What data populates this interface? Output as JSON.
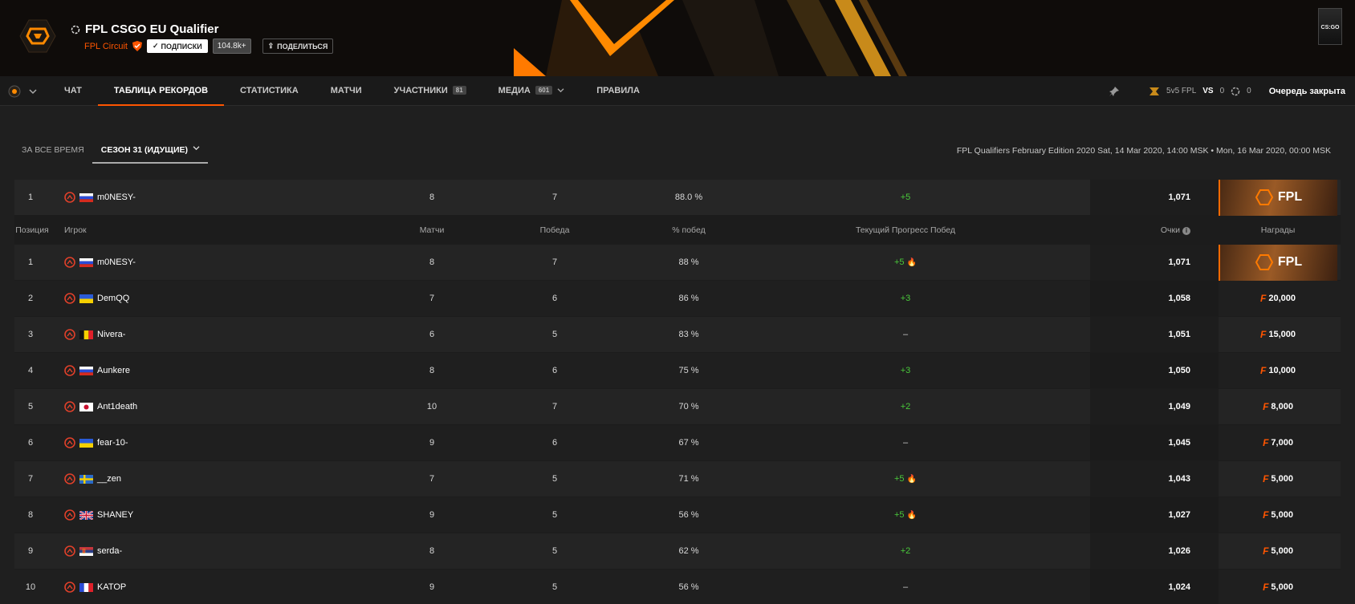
{
  "header": {
    "title": "FPL CSGO EU Qualifier",
    "org_name": "FPL Circuit",
    "follow_label": "ПОДПИСКИ",
    "follow_count": "104.8k+",
    "share_label": "ПОДЕЛИТЬСЯ",
    "game_thumb_label": "CS:GO"
  },
  "nav": {
    "tabs": [
      {
        "label": "ЧАТ",
        "badge": ""
      },
      {
        "label": "ТАБЛИЦА РЕКОРДОВ",
        "badge": ""
      },
      {
        "label": "СТАТИСТИКА",
        "badge": ""
      },
      {
        "label": "МАТЧИ",
        "badge": ""
      },
      {
        "label": "УЧАСТНИКИ",
        "badge": "81"
      },
      {
        "label": "МЕДИА",
        "badge": "601"
      },
      {
        "label": "ПРАВИЛА",
        "badge": ""
      }
    ],
    "queue_mode": "5v5 FPL",
    "vs_label": "VS",
    "queue_count_a": "0",
    "queue_count_b": "0",
    "queue_status": "Очередь закрыта"
  },
  "filters": {
    "all_time": "ЗА ВСЕ ВРЕМЯ",
    "season": "СЕЗОН 31 (ИДУЩИЕ)"
  },
  "season_info": "FPL Qualifiers February Edition 2020  Sat, 14 Mar 2020, 14:00 MSK • Mon, 16 Mar 2020, 00:00 MSK",
  "pinned": {
    "pos": "1",
    "name": "m0NESY-",
    "flag": "ru",
    "matches": "8",
    "wins": "7",
    "winrate": "88.0 %",
    "streak": "+5",
    "points": "1,071",
    "reward_label": "FPL"
  },
  "columns": {
    "position": "Позиция",
    "player": "Игрок",
    "matches": "Матчи",
    "wins": "Победа",
    "winrate": "% побед",
    "streak": "Текущий Прогресс Побед",
    "points": "Очки",
    "rewards": "Награды"
  },
  "rows": [
    {
      "pos": "1",
      "name": "m0NESY-",
      "flag": "ru",
      "matches": "8",
      "wins": "7",
      "winrate": "88 %",
      "streak": "+5",
      "fire": true,
      "points": "1,071",
      "reward": "",
      "reward_banner": "FPL"
    },
    {
      "pos": "2",
      "name": "DemQQ",
      "flag": "ua",
      "matches": "7",
      "wins": "6",
      "winrate": "86 %",
      "streak": "+3",
      "fire": false,
      "points": "1,058",
      "reward": "20,000"
    },
    {
      "pos": "3",
      "name": "Nivera-",
      "flag": "be",
      "matches": "6",
      "wins": "5",
      "winrate": "83 %",
      "streak": "–",
      "fire": false,
      "points": "1,051",
      "reward": "15,000"
    },
    {
      "pos": "4",
      "name": "Aunkere",
      "flag": "ru",
      "matches": "8",
      "wins": "6",
      "winrate": "75 %",
      "streak": "+3",
      "fire": false,
      "points": "1,050",
      "reward": "10,000"
    },
    {
      "pos": "5",
      "name": "Ant1death",
      "flag": "jp",
      "matches": "10",
      "wins": "7",
      "winrate": "70 %",
      "streak": "+2",
      "fire": false,
      "points": "1,049",
      "reward": "8,000"
    },
    {
      "pos": "6",
      "name": "fear-10-",
      "flag": "ua",
      "matches": "9",
      "wins": "6",
      "winrate": "67 %",
      "streak": "–",
      "fire": false,
      "points": "1,045",
      "reward": "7,000"
    },
    {
      "pos": "7",
      "name": "__zen",
      "flag": "se",
      "matches": "7",
      "wins": "5",
      "winrate": "71 %",
      "streak": "+5",
      "fire": true,
      "points": "1,043",
      "reward": "5,000"
    },
    {
      "pos": "8",
      "name": "SHANEY",
      "flag": "gb",
      "matches": "9",
      "wins": "5",
      "winrate": "56 %",
      "streak": "+5",
      "fire": true,
      "points": "1,027",
      "reward": "5,000"
    },
    {
      "pos": "9",
      "name": "serda-",
      "flag": "rs",
      "matches": "8",
      "wins": "5",
      "winrate": "62 %",
      "streak": "+2",
      "fire": false,
      "points": "1,026",
      "reward": "5,000"
    },
    {
      "pos": "10",
      "name": "KATOP",
      "flag": "fr",
      "matches": "9",
      "wins": "5",
      "winrate": "56 %",
      "streak": "–",
      "fire": false,
      "points": "1,024",
      "reward": "5,000"
    }
  ],
  "colors": {
    "accent": "#ff5500",
    "streak_green": "#49c93a",
    "background": "#1f1f1f"
  }
}
